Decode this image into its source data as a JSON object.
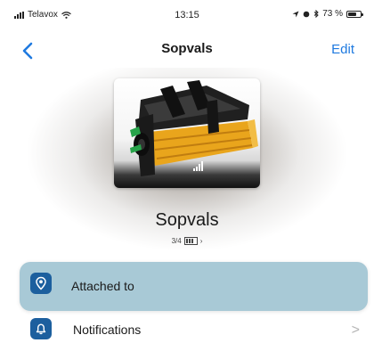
{
  "status_bar": {
    "carrier": "Telavox",
    "time": "13:15",
    "battery_text": "73 %",
    "battery_level": 0.73,
    "icons": [
      "signal-icon",
      "wifi-icon",
      "location-icon",
      "alarm-icon",
      "bluetooth-icon",
      "battery-icon"
    ]
  },
  "nav": {
    "back_icon": "chevron-left-icon",
    "title": "Sopvals",
    "edit_label": "Edit"
  },
  "product": {
    "name": "Sopvals",
    "status_text": "3/4",
    "signal_icon": "signal-strength-icon",
    "battery_icon": "battery-icon"
  },
  "list": {
    "items": [
      {
        "label": "Attached to",
        "icon": "location-pin-icon",
        "highlighted": true
      },
      {
        "label": "Notifications",
        "icon": "bell-icon",
        "highlighted": false,
        "chevron": ">"
      }
    ]
  },
  "colors": {
    "accent": "#1f7ae0",
    "icon_bg": "#1c5f9e",
    "highlight_row": "#a8c9d6"
  }
}
